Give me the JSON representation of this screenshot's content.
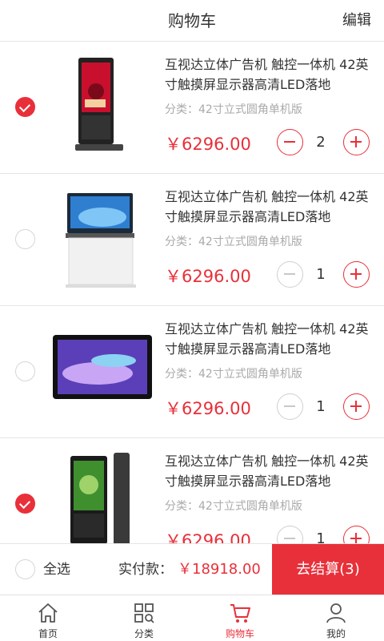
{
  "header": {
    "title": "购物车",
    "edit": "编辑"
  },
  "items": [
    {
      "name": "互视达立体广告机 触控一体机 42英寸触摸屏显示器高清LED落地",
      "spec": "分类：42寸立式圆角单机版",
      "price": "￥6296.00",
      "qty": "2",
      "checked": true,
      "minus_enabled": true,
      "thumb": "standing-kiosk"
    },
    {
      "name": "互视达立体广告机 触控一体机 42英寸触摸屏显示器高清LED落地",
      "spec": "分类：42寸立式圆角单机版",
      "price": "￥6296.00",
      "qty": "1",
      "checked": false,
      "minus_enabled": false,
      "thumb": "white-cabinet-display"
    },
    {
      "name": "互视达立体广告机 触控一体机 42英寸触摸屏显示器高清LED落地",
      "spec": "分类：42寸立式圆角单机版",
      "price": "￥6296.00",
      "qty": "1",
      "checked": false,
      "minus_enabled": false,
      "thumb": "wall-display"
    },
    {
      "name": "互视达立体广告机 触控一体机 42英寸触摸屏显示器高清LED落地",
      "spec": "分类：42寸立式圆角单机版",
      "price": "￥6296.00",
      "qty": "1",
      "checked": true,
      "minus_enabled": false,
      "thumb": "dual-kiosk"
    }
  ],
  "checkout": {
    "select_all": "全选",
    "total_label": "实付款：",
    "total_value": "￥18918.00",
    "pay_button": "去结算(3)"
  },
  "tabbar": [
    {
      "label": "首页",
      "icon": "home-icon",
      "active": false
    },
    {
      "label": "分类",
      "icon": "category-icon",
      "active": false
    },
    {
      "label": "购物车",
      "icon": "cart-icon",
      "active": true
    },
    {
      "label": "我的",
      "icon": "user-icon",
      "active": false
    }
  ],
  "colors": {
    "accent": "#e8303a",
    "text": "#333333",
    "muted": "#aaaaaa"
  }
}
